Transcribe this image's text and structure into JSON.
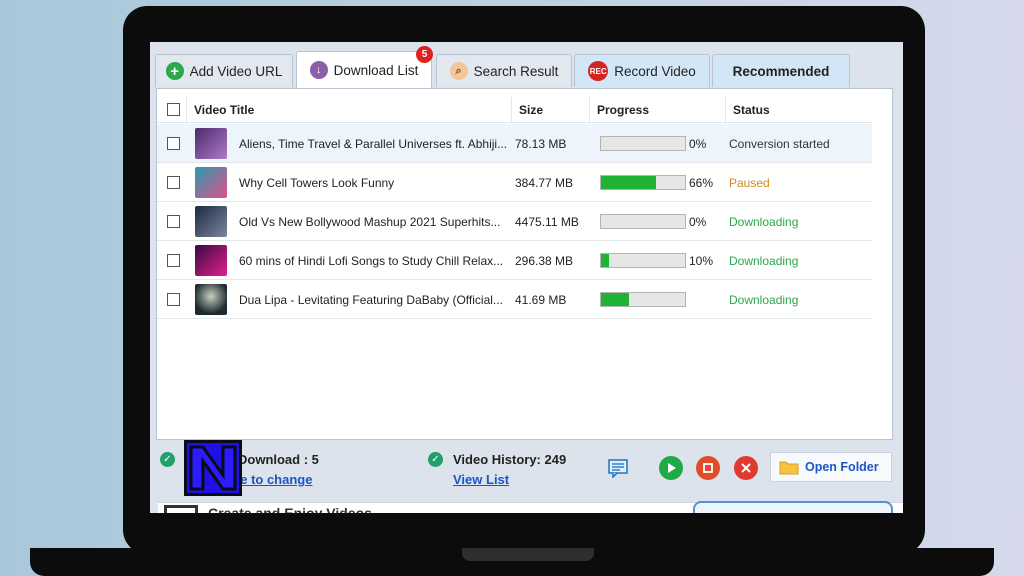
{
  "tabs": [
    {
      "label": "Add Video URL",
      "icon": "plus-icon",
      "color": "#2aa84a"
    },
    {
      "label": "Download List",
      "icon": "download-icon",
      "color": "#8b5fa8",
      "badge": "5"
    },
    {
      "label": "Search Result",
      "icon": "magnifier-icon",
      "color": "#e07b39"
    },
    {
      "label": "Record Video",
      "icon": "rec-icon",
      "color": "#d42424",
      "icon_text": "REC"
    },
    {
      "label": "Recommended"
    }
  ],
  "table": {
    "headers": {
      "title": "Video Title",
      "size": "Size",
      "progress": "Progress",
      "status": "Status"
    },
    "rows": [
      {
        "title": "Aliens, Time Travel & Parallel Universes ft. Abhiji...",
        "size": "78.13 MB",
        "progress": 0,
        "pct": "0%",
        "status": "Conversion started",
        "status_color": "#333333",
        "thumb": "#6a3f8c"
      },
      {
        "title": "Why Cell Towers Look Funny",
        "size": "384.77 MB",
        "progress": 0.66,
        "pct": "66%",
        "status": "Paused",
        "status_color": "#d08a1a",
        "thumb": "#e0508c"
      },
      {
        "title": "Old Vs New Bollywood Mashup 2021 Superhits...",
        "size": "4475.11 MB",
        "progress": 0,
        "pct": "0%",
        "status": "Downloading",
        "status_color": "#2aa84a",
        "thumb": "#3a4560"
      },
      {
        "title": "60 mins of Hindi Lofi Songs to Study Chill Relax...",
        "size": "296.38 MB",
        "progress": 0.1,
        "pct": "10%",
        "status": "Downloading",
        "status_color": "#2aa84a",
        "thumb": "#b02070"
      },
      {
        "title": "Dua Lipa - Levitating Featuring DaBaby (Official...",
        "size": "41.69 MB",
        "progress": 0.33,
        "pct": "",
        "status": "Downloading",
        "status_color": "#2aa84a",
        "thumb": "#2c3a44"
      }
    ]
  },
  "bottom": {
    "download_label": "Download : 5",
    "change_link": "here to change",
    "history_label": "Video History: 249",
    "view_list": "View List",
    "open_folder": "Open Folder"
  },
  "promo": {
    "text": "Create and Enjoy Videos"
  }
}
